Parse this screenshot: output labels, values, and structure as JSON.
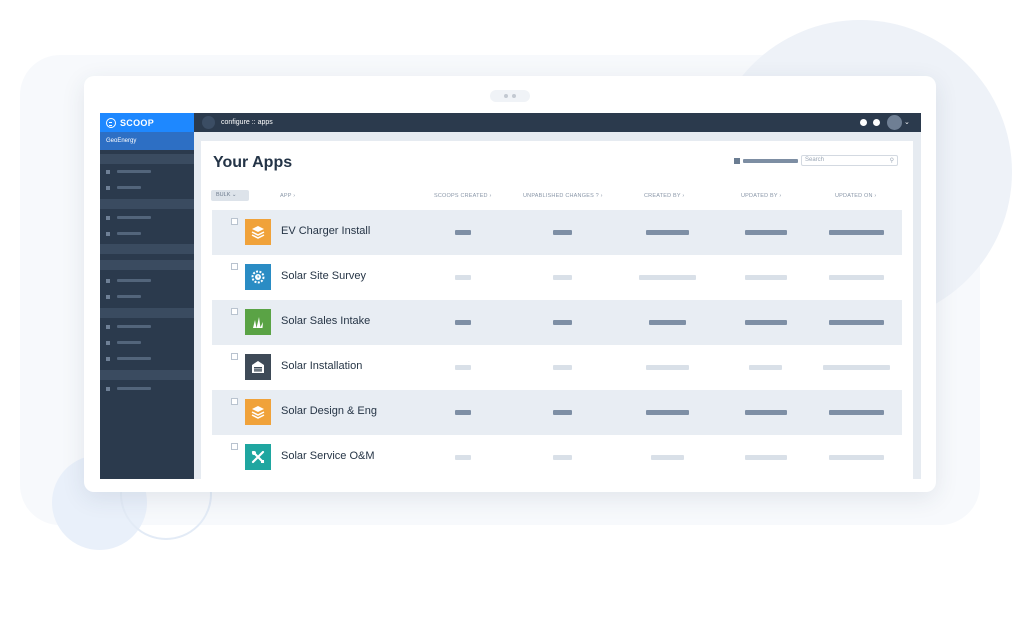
{
  "window": {
    "dots": [
      "dot",
      "dot"
    ]
  },
  "brand": {
    "name": "SCOOP",
    "org": "GeoEnergy"
  },
  "topbar": {
    "title": "configure :: apps"
  },
  "page": {
    "title": "Your Apps"
  },
  "search": {
    "placeholder": "Search"
  },
  "table": {
    "bulk_label": "BULK",
    "columns": [
      "APP",
      "SCOOPS CREATED",
      "UNPABLISHED CHANGES ?",
      "CREATED BY",
      "UPDATED BY",
      "UPDATED ON"
    ],
    "rows": [
      {
        "name": "EV Charger Install",
        "icon": "layers-icon",
        "icon_color": "#f0a23a"
      },
      {
        "name": "Solar Site Survey",
        "icon": "gear-clock-icon",
        "icon_color": "#2a8cc4"
      },
      {
        "name": "Solar Sales Intake",
        "icon": "grass-icon",
        "icon_color": "#5aa345"
      },
      {
        "name": "Solar Installation",
        "icon": "garage-icon",
        "icon_color": "#3e4a57"
      },
      {
        "name": "Solar Design & Eng",
        "icon": "layers-icon",
        "icon_color": "#f0a23a"
      },
      {
        "name": "Solar Service O&M",
        "icon": "tools-icon",
        "icon_color": "#1fa6a0"
      }
    ]
  },
  "colors": {
    "brand": "#1e88ff",
    "sidebar": "#2b3a4d",
    "row_shade": "#e8edf3"
  }
}
